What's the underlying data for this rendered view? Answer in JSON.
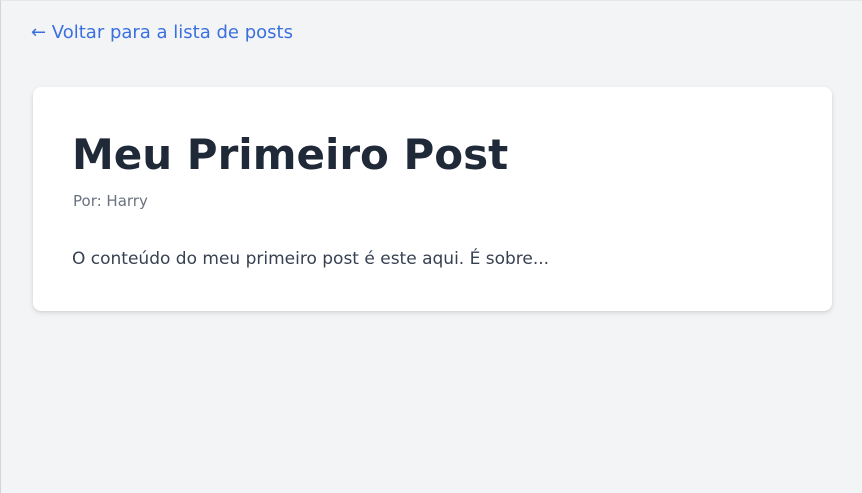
{
  "nav": {
    "back_link": "← Voltar para a lista de posts"
  },
  "post": {
    "title": "Meu Primeiro Post",
    "author": "Por: Harry",
    "content": "O conteúdo do meu primeiro post é este aqui. É sobre..."
  },
  "colors": {
    "link": "#3b6fe0",
    "title": "#1f2937",
    "muted": "#6b7280",
    "body_text": "#374151",
    "background": "#f3f4f6",
    "card": "#ffffff"
  }
}
